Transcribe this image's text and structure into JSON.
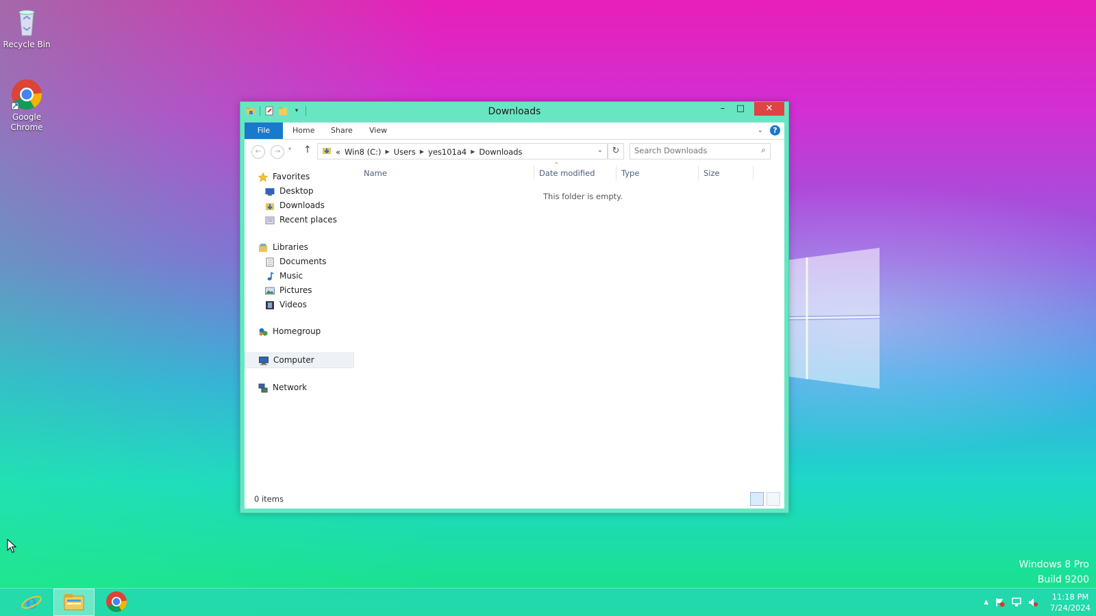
{
  "desktop": {
    "icons": [
      {
        "label": "Recycle Bin",
        "icon": "recycle-bin-icon"
      },
      {
        "label": "Google Chrome",
        "icon": "chrome-icon"
      }
    ],
    "watermark": {
      "line1": "Windows 8 Pro",
      "line2": "Build 9200"
    }
  },
  "window": {
    "title": "Downloads",
    "controls": {
      "minimize": "–",
      "maximize": "□",
      "close": "✕"
    },
    "ribbon": {
      "tabs": [
        "File",
        "Home",
        "Share",
        "View"
      ],
      "help": "?"
    },
    "address": {
      "overflow": "«",
      "crumbs": [
        "Win8 (C:)",
        "Users",
        "yes101a4",
        "Downloads"
      ]
    },
    "search": {
      "placeholder": "Search Downloads"
    },
    "nav": {
      "favorites": {
        "label": "Favorites",
        "items": [
          "Desktop",
          "Downloads",
          "Recent places"
        ]
      },
      "libraries": {
        "label": "Libraries",
        "items": [
          "Documents",
          "Music",
          "Pictures",
          "Videos"
        ]
      },
      "homegroup": "Homegroup",
      "computer": "Computer",
      "network": "Network"
    },
    "columns": [
      "Name",
      "Date modified",
      "Type",
      "Size"
    ],
    "empty_message": "This folder is empty.",
    "status": "0 items"
  },
  "taskbar": {
    "apps": [
      "internet-explorer-icon",
      "file-explorer-icon",
      "chrome-icon"
    ],
    "active_app": "file-explorer-icon",
    "clock": {
      "time": "11:18 PM",
      "date": "7/24/2024"
    }
  },
  "colors": {
    "accent": "#1979ca",
    "window_frame": "#68e6c4",
    "close": "#e04343"
  }
}
